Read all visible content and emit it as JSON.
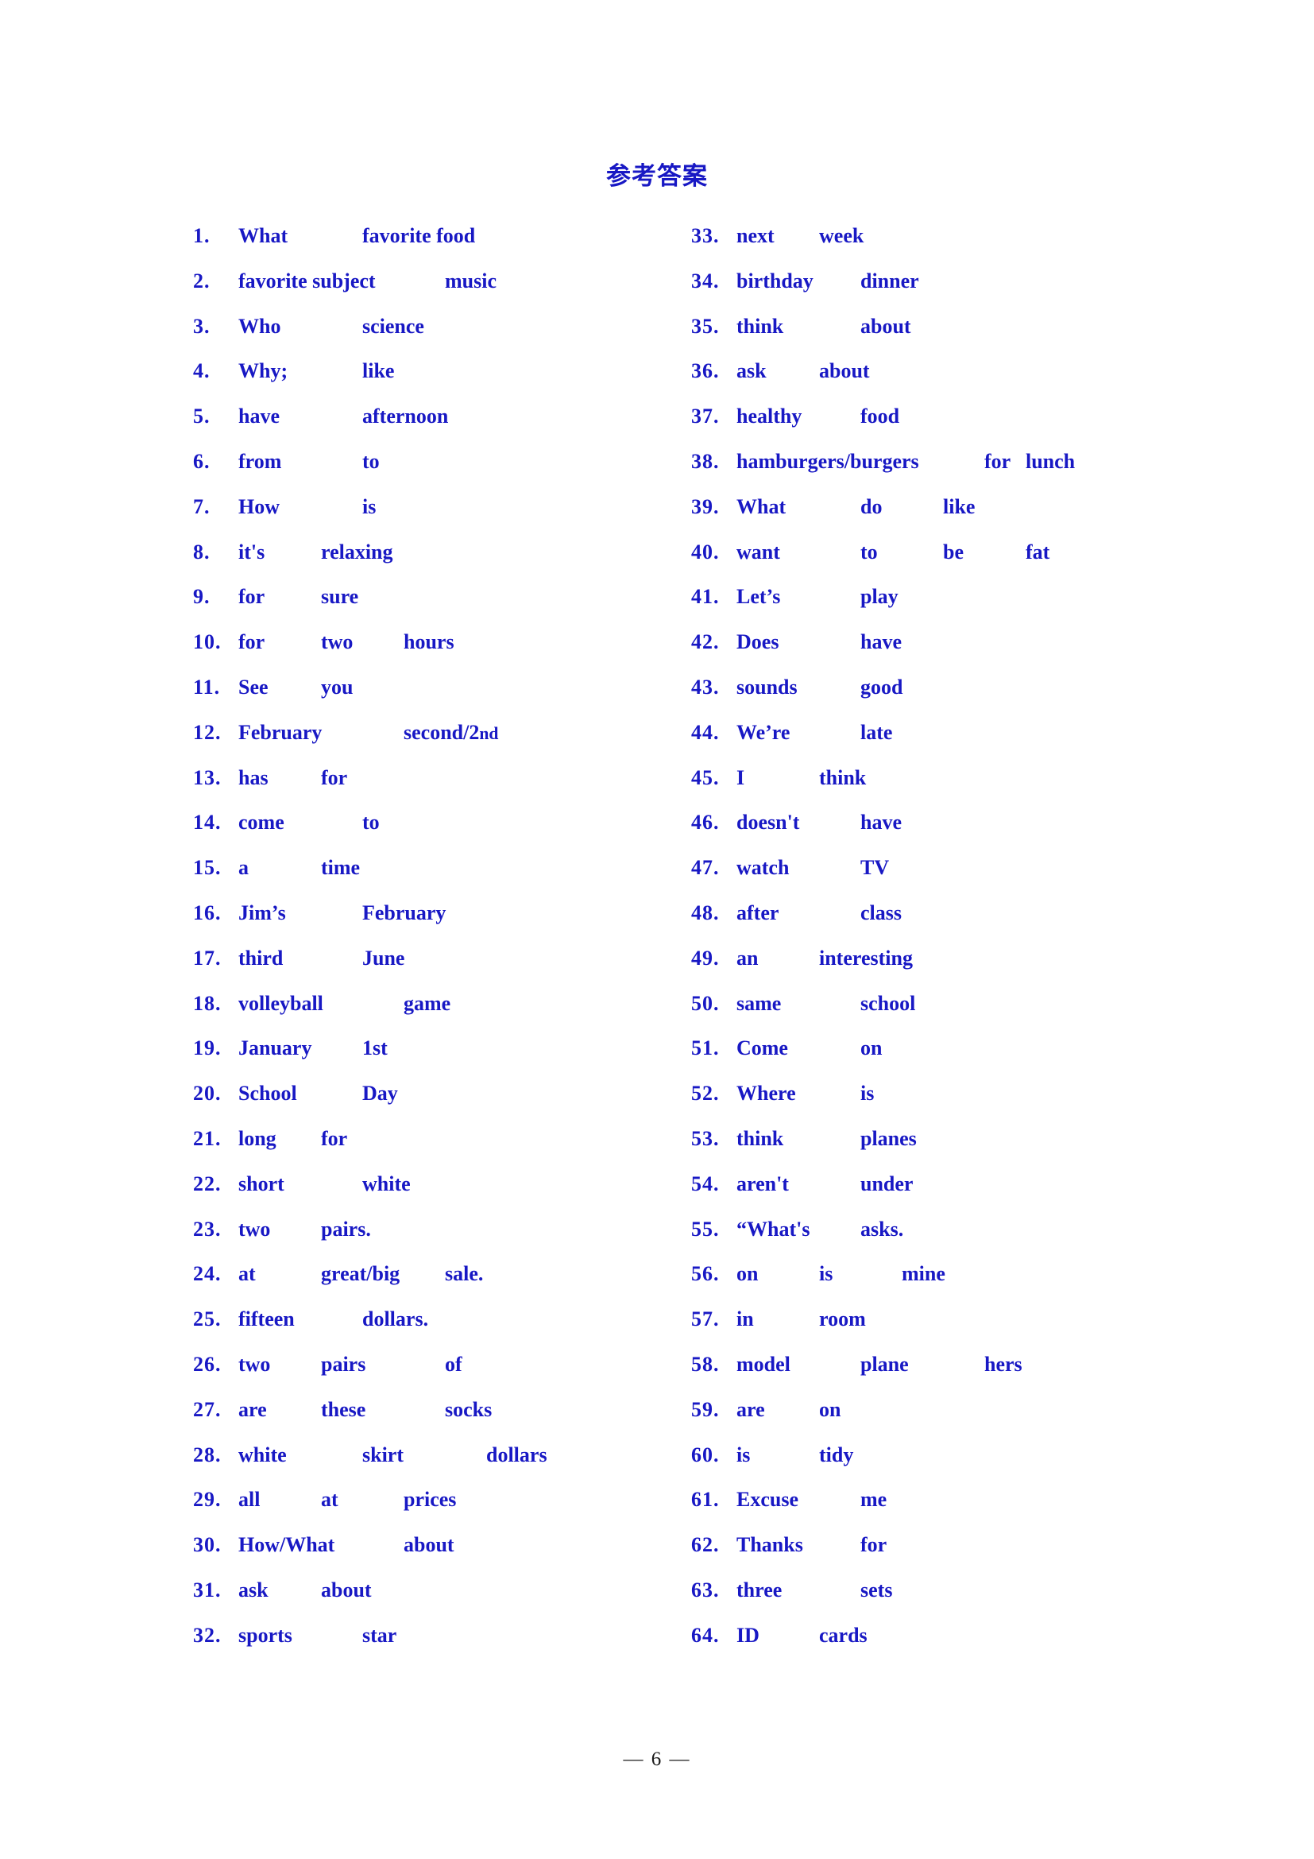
{
  "document": {
    "title": "参考答案",
    "page_footer": "— 6 —",
    "text_color": "#1818C4",
    "footer_color": "#1a1a1a"
  },
  "answers": {
    "left_column": [
      {
        "num": "1.",
        "text": "What\t\tfavorite food"
      },
      {
        "num": "2.",
        "text": "favorite subject\t\tmusic"
      },
      {
        "num": "3.",
        "text": "Who\t\tscience"
      },
      {
        "num": "4.",
        "text": "Why;\t\tlike"
      },
      {
        "num": "5.",
        "text": "have\t\tafternoon"
      },
      {
        "num": "6.",
        "text": "from\t\tto"
      },
      {
        "num": "7.",
        "text": "How\t\tis"
      },
      {
        "num": "8.",
        "text": "it's\t\trelaxing"
      },
      {
        "num": "9.",
        "text": "for\t\tsure"
      },
      {
        "num": "10.",
        "text": "for\t\ttwo\t\thours"
      },
      {
        "num": "11.",
        "text": "See\t\tyou"
      },
      {
        "num": "12.",
        "text": "February\t\tsecond/2",
        "sup": "nd"
      },
      {
        "num": "13.",
        "text": "has\t\tfor"
      },
      {
        "num": "14.",
        "text": "come\t\tto"
      },
      {
        "num": "15.",
        "text": "a\t\ttime"
      },
      {
        "num": "16.",
        "text": "Jim’s\t\tFebruary"
      },
      {
        "num": "17.",
        "text": "third\t\tJune"
      },
      {
        "num": "18.",
        "text": "volleyball\t\tgame"
      },
      {
        "num": "19.",
        "text": "January\t\t1st"
      },
      {
        "num": "20.",
        "text": "School\t\tDay"
      },
      {
        "num": "21.",
        "text": "long\t\tfor"
      },
      {
        "num": "22.",
        "text": "short\t\twhite"
      },
      {
        "num": "23.",
        "text": "two\t\tpairs."
      },
      {
        "num": "24.",
        "text": "at\t\tgreat/big\t\tsale."
      },
      {
        "num": "25.",
        "text": "fifteen\t\tdollars."
      },
      {
        "num": "26.",
        "text": "two\t\tpairs\t\tof"
      },
      {
        "num": "27.",
        "text": "are\t\tthese\t\tsocks"
      },
      {
        "num": "28.",
        "text": "white\t\tskirt\t\tdollars"
      },
      {
        "num": "29.",
        "text": "all\t\tat\t\tprices"
      },
      {
        "num": "30.",
        "text": "How/What\t\tabout"
      },
      {
        "num": "31.",
        "text": "ask\t\tabout"
      },
      {
        "num": "32.",
        "text": "sports\t\tstar"
      }
    ],
    "right_column": [
      {
        "num": "33.",
        "text": "next\t\tweek"
      },
      {
        "num": "34.",
        "text": "birthday\t\tdinner"
      },
      {
        "num": "35.",
        "text": "think\t\tabout"
      },
      {
        "num": "36.",
        "text": "ask\t\tabout"
      },
      {
        "num": "37.",
        "text": "healthy\t\tfood"
      },
      {
        "num": "38.",
        "text": "hamburgers/burgers\t\tfor\tlunch"
      },
      {
        "num": "39.",
        "text": "What\t\tdo\t\tlike"
      },
      {
        "num": "40.",
        "text": "want\t\tto\t\tbe\t\tfat"
      },
      {
        "num": "41.",
        "text": "Let’s\t\tplay"
      },
      {
        "num": "42.",
        "text": "Does\t\thave"
      },
      {
        "num": "43.",
        "text": "sounds\t\tgood"
      },
      {
        "num": "44.",
        "text": "We’re\t\tlate"
      },
      {
        "num": "45.",
        "text": "I\t\tthink"
      },
      {
        "num": "46.",
        "text": "doesn't\t\thave"
      },
      {
        "num": "47.",
        "text": "watch\t\tTV"
      },
      {
        "num": "48.",
        "text": "after\t\tclass"
      },
      {
        "num": "49.",
        "text": "an\t\tinteresting"
      },
      {
        "num": "50.",
        "text": "same\t\tschool"
      },
      {
        "num": "51.",
        "text": "Come\t\ton"
      },
      {
        "num": "52.",
        "text": "Where\t\tis"
      },
      {
        "num": "53.",
        "text": "think\t\tplanes"
      },
      {
        "num": "54.",
        "text": "aren't\t\tunder"
      },
      {
        "num": "55.",
        "text": "“What's\t\tasks."
      },
      {
        "num": "56.",
        "text": "on\t\tis\t\tmine"
      },
      {
        "num": "57.",
        "text": "in\t\troom"
      },
      {
        "num": "58.",
        "text": "model\t\tplane\t\thers"
      },
      {
        "num": "59.",
        "text": "are\t\ton"
      },
      {
        "num": "60.",
        "text": "is\t\ttidy"
      },
      {
        "num": "61.",
        "text": "Excuse\t\tme"
      },
      {
        "num": "62.",
        "text": "Thanks\t\tfor"
      },
      {
        "num": "63.",
        "text": "three\t\tsets"
      },
      {
        "num": "64.",
        "text": "ID\t\tcards"
      }
    ]
  }
}
